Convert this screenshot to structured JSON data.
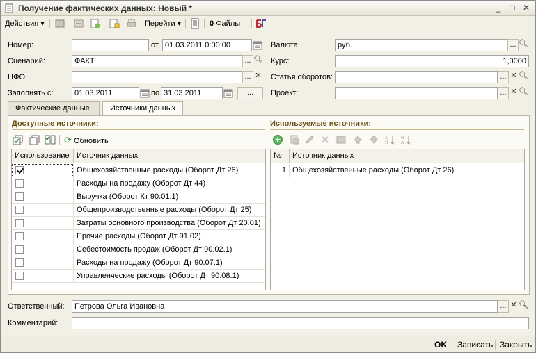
{
  "window": {
    "title": "Получение фактических данных: Новый *",
    "minimize": "_",
    "maximize": "□",
    "close": "✕"
  },
  "toolbar": {
    "actions_label": "Действия",
    "goto_label": "Перейти",
    "files_label": "Файлы"
  },
  "form": {
    "number_label": "Номер:",
    "number_value": "",
    "from_label": "от",
    "date_value": "01.03.2011  0:00:00",
    "scenario_label": "Сценарий:",
    "scenario_value": "ФАКТ",
    "cfo_label": "ЦФО:",
    "cfo_value": "",
    "fill_from_label": "Заполнять с:",
    "fill_from_value": "01.03.2011",
    "to_label": "по",
    "fill_to_value": "31.03.2011",
    "period_btn": "...",
    "currency_label": "Валюта:",
    "currency_value": "руб.",
    "rate_label": "Курс:",
    "rate_value": "1,0000",
    "turnover_label": "Статья оборотов:",
    "turnover_value": "",
    "project_label": "Проект:",
    "project_value": "",
    "dots": "...",
    "x": "✕"
  },
  "tabs": [
    {
      "label": "Фактические данные",
      "active": false
    },
    {
      "label": "Источники данных",
      "active": true
    }
  ],
  "available": {
    "title": "Доступные источники:",
    "refresh_label": "Обновить",
    "columns": [
      "Использование",
      "Источник данных"
    ],
    "rows": [
      {
        "checked": true,
        "source": "Общехозяйственные расходы (Оборот Дт 26)"
      },
      {
        "checked": false,
        "source": "Расходы на продажу (Оборот Дт 44)"
      },
      {
        "checked": false,
        "source": "Выручка (Оборот Кт 90.01.1)"
      },
      {
        "checked": false,
        "source": "Общепроизводственные расходы (Оборот Дт 25)"
      },
      {
        "checked": false,
        "source": "Затраты основного производства (Оборот Дт 20.01)"
      },
      {
        "checked": false,
        "source": "Прочие расходы (Оборот Дт 91.02)"
      },
      {
        "checked": false,
        "source": "Себестоимость продаж (Оборот Дт 90.02.1)"
      },
      {
        "checked": false,
        "source": "Расходы на продажу (Оборот Дт 90.07.1)"
      },
      {
        "checked": false,
        "source": "Управленческие расходы (Оборот Дт 90.08.1)"
      }
    ]
  },
  "used": {
    "title": "Используемые источники:",
    "columns": [
      "№",
      "Источник данных"
    ],
    "rows": [
      {
        "num": "1",
        "source": "Общехозяйственные расходы (Оборот Дт 26)"
      }
    ]
  },
  "footer": {
    "responsible_label": "Ответственный:",
    "responsible_value": "Петрова Ольга Ивановна",
    "comment_label": "Комментарий:",
    "comment_value": ""
  },
  "bottom": {
    "ok": "OK",
    "save": "Записать",
    "close": "Закрыть"
  },
  "colors": {
    "section_title": "#6b4f12",
    "window_bg": "#f2efe4"
  }
}
